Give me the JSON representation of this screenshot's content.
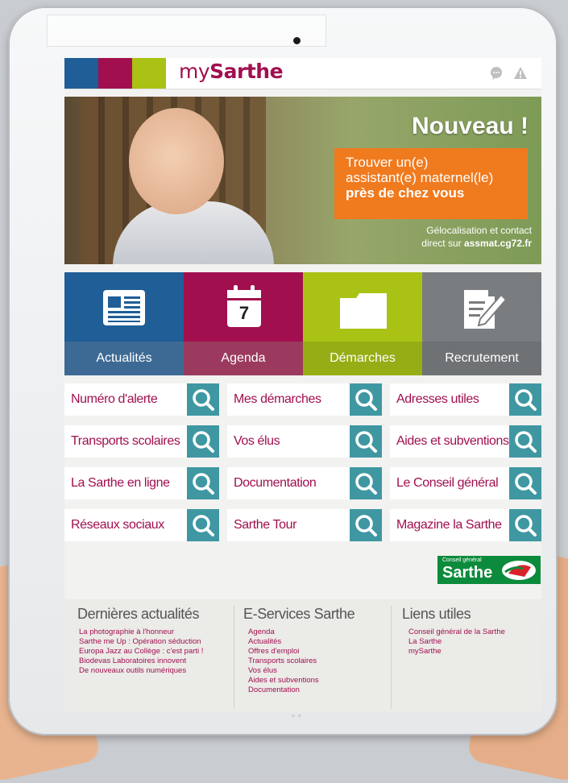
{
  "app": {
    "logo_prefix": "my",
    "logo_name": "Sarthe",
    "header_colors": [
      "#1f5e96",
      "#a10f4f",
      "#a9c214"
    ],
    "icons": [
      "chat-icon",
      "alert-icon"
    ]
  },
  "banner": {
    "title": "Nouveau !",
    "line1": "Trouver un(e)",
    "line2": "assistant(e) maternel(le)",
    "line3": "près de chez vous",
    "sub1": "Gélocalisation et contact",
    "sub2_prefix": "direct sur ",
    "sub2_link": "assmat.cg72.fr"
  },
  "tiles": [
    {
      "label": "Actualités",
      "icon": "newspaper-icon",
      "top_color": "#1f5e96",
      "bottom_color": "#3d6a94"
    },
    {
      "label": "Agenda",
      "icon": "calendar-icon",
      "top_color": "#a10f4f",
      "bottom_color": "#9b3a5e",
      "icon_text": "7"
    },
    {
      "label": "Démarches",
      "icon": "folder-icon",
      "top_color": "#a9c214",
      "bottom_color": "#97ad15"
    },
    {
      "label": "Recrutement",
      "icon": "edit-document-icon",
      "top_color": "#7a7d80",
      "bottom_color": "#6f7275"
    }
  ],
  "links": [
    [
      "Numéro d'alerte",
      "Mes démarches",
      "Adresses utiles"
    ],
    [
      "Transports scolaires",
      "Vos élus",
      "Aides et subventions"
    ],
    [
      "La Sarthe en ligne",
      "Documentation",
      "Le Conseil général"
    ],
    [
      "Réseaux sociaux",
      "Sarthe Tour",
      "Magazine la Sarthe"
    ]
  ],
  "cg_logo": {
    "small": "Conseil général",
    "big": "Sarthe"
  },
  "footer": {
    "news": {
      "title": "Dernières actualités",
      "items": [
        "La photographie à l'honneur",
        "Sarthe me Up : Opération séduction",
        "Europa Jazz au Collège : c'est parti !",
        "Biodevas Laboratoires innovent",
        "De nouveaux outils numériques"
      ]
    },
    "services": {
      "title": "E-Services Sarthe",
      "items": [
        "Agenda",
        "Actualités",
        "Offres d'emploi",
        "Transports scolaires",
        "Vos élus",
        "Aides et subventions",
        "Documentation"
      ]
    },
    "links": {
      "title": "Liens utiles",
      "items": [
        "Conseil général de la Sarthe",
        "La Sarthe",
        "mySarthe"
      ]
    }
  }
}
